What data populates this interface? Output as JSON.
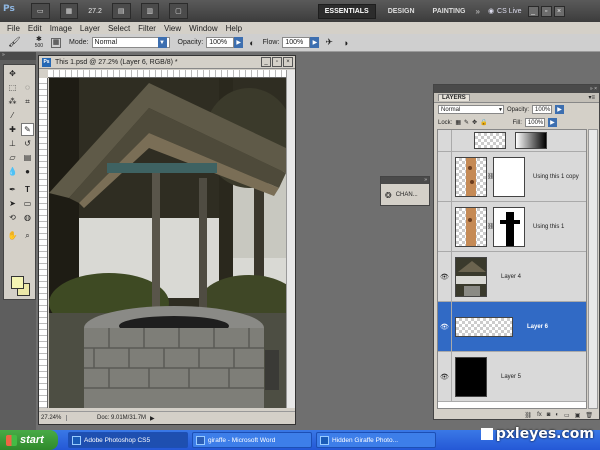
{
  "app": {
    "logo": "Ps",
    "zoom": "27.2",
    "workspaces": [
      {
        "label": "ESSENTIALS",
        "active": true
      },
      {
        "label": "DESIGN",
        "active": false
      },
      {
        "label": "PAINTING",
        "active": false
      }
    ],
    "more": "»",
    "cs_live": "CS Live"
  },
  "menu": [
    "File",
    "Edit",
    "Image",
    "Layer",
    "Select",
    "Filter",
    "View",
    "Window",
    "Help"
  ],
  "options": {
    "brush_size": "500",
    "mode_label": "Mode:",
    "mode_value": "Normal",
    "opacity_label": "Opacity:",
    "opacity_value": "100%",
    "flow_label": "Flow:",
    "flow_value": "100%"
  },
  "document": {
    "title": "This 1.psd @ 27.2% (Layer 6, RGB/8) *",
    "zoom": "27.24%",
    "info": "Doc: 9.01M/31.7M"
  },
  "channels_panel": {
    "label": "CHAN..."
  },
  "layers_panel": {
    "tab": "LAYERS",
    "blend_mode": "Normal",
    "opacity_label": "Opacity:",
    "opacity_value": "100%",
    "lock_label": "Lock:",
    "fill_label": "Fill:",
    "fill_value": "100%",
    "layers": [
      {
        "name": "Using this 1 copy",
        "visible": false,
        "selected": false
      },
      {
        "name": "Using this 1",
        "visible": false,
        "selected": false
      },
      {
        "name": "Layer 4",
        "visible": true,
        "selected": false
      },
      {
        "name": "Layer 6",
        "visible": true,
        "selected": true
      },
      {
        "name": "Layer 5",
        "visible": true,
        "selected": false
      }
    ]
  },
  "taskbar": {
    "start": "start",
    "tasks": [
      {
        "label": "Adobe Photoshop CS5",
        "active": true
      },
      {
        "label": "giraffe - Microsoft Word",
        "active": false
      },
      {
        "label": "Hidden Giraffe Photo...",
        "active": false
      }
    ]
  },
  "watermark": "pxleyes.com",
  "colors": {
    "app_bar": "#3c3c3c",
    "panel_bg": "#d4d0c8",
    "selection": "#316ac5",
    "taskbar": "#2458d6",
    "foreground_swatch": "#f4f4b4"
  }
}
